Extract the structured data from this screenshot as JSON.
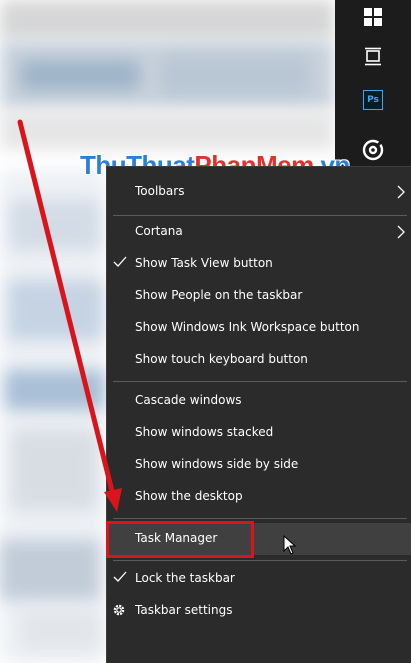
{
  "watermark": {
    "part1": "ThuThuat",
    "part2": "PhanMem",
    "part3": ".vn"
  },
  "taskbar": {
    "icons": [
      "windows-start-icon",
      "task-view-icon",
      "photoshop-icon",
      "groove-music-icon"
    ],
    "ps_label": "Ps"
  },
  "menu": {
    "toolbars": "Toolbars",
    "cortana": "Cortana",
    "show_task_view": "Show Task View button",
    "show_people": "Show People on the taskbar",
    "show_ink": "Show Windows Ink Workspace button",
    "show_touch_keyboard": "Show touch keyboard button",
    "cascade": "Cascade windows",
    "stacked": "Show windows stacked",
    "side_by_side": "Show windows side by side",
    "show_desktop": "Show the desktop",
    "task_manager": "Task Manager",
    "lock_taskbar": "Lock the taskbar",
    "taskbar_settings": "Taskbar settings"
  },
  "colors": {
    "menu_bg": "#2b2b2b",
    "hover_bg": "#404040",
    "highlight_red": "#d9141b",
    "photoshop_blue": "#31a8ff"
  }
}
